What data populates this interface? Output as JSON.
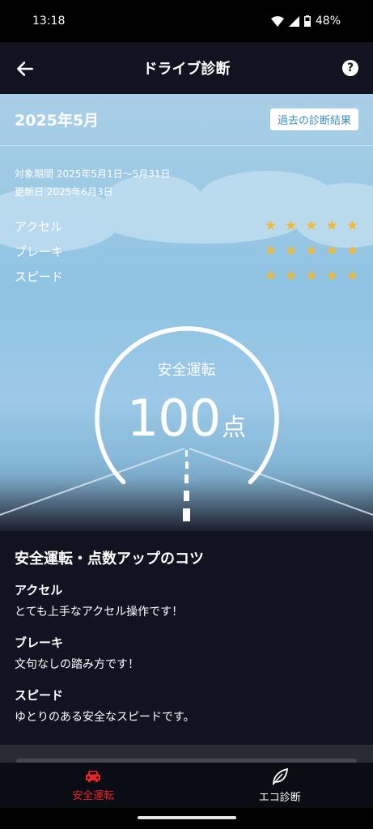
{
  "status_bar": {
    "time": "13:18",
    "battery": "48%"
  },
  "app_bar": {
    "title": "ドライブ診断",
    "help_icon_label": "?"
  },
  "hero": {
    "month": "2025年5月",
    "past_results_button": "過去の診断結果",
    "period_line": "対象期間 2025年5月1日〜5月31日",
    "updated_line": "更新日 2025年6月3日",
    "ratings": [
      {
        "label": "アクセル",
        "stars": 5
      },
      {
        "label": "ブレーキ",
        "stars": 5
      },
      {
        "label": "スピード",
        "stars": 5
      }
    ],
    "gauge_label": "安全運転",
    "score": "100",
    "score_unit": "点",
    "score_fraction": 1.0
  },
  "tips": {
    "heading": "安全運転・点数アップのコツ",
    "items": [
      {
        "title": "アクセル",
        "body": "とても上手なアクセル操作です！"
      },
      {
        "title": "ブレーキ",
        "body": "文句なしの踏み方です！"
      },
      {
        "title": "スピード",
        "body": "ゆとりのある安全なスピードです。"
      }
    ]
  },
  "bottom_nav": [
    {
      "label": "安全運転",
      "icon": "car-icon",
      "active": true
    },
    {
      "label": "エコ診断",
      "icon": "leaf-icon",
      "active": false
    }
  ],
  "colors": {
    "accent_red": "#e8262a",
    "star": "#f4b731",
    "sky": "#9cc9e6"
  }
}
